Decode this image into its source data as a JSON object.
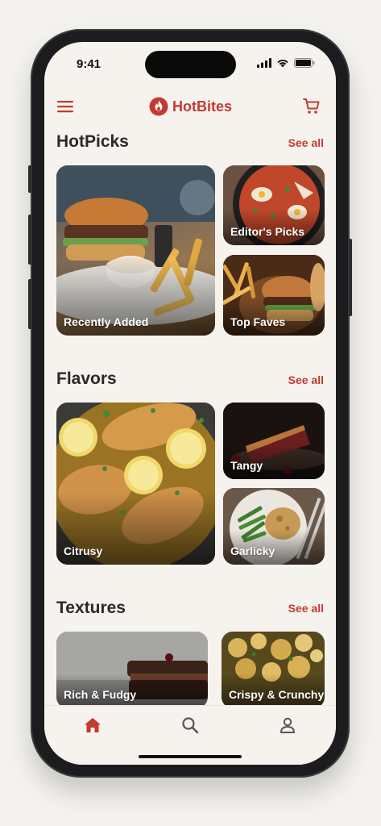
{
  "status_bar": {
    "time": "9:41"
  },
  "header": {
    "app_name": "HotBites",
    "icons": [
      "menu-icon",
      "flame-logo-icon",
      "cart-icon"
    ]
  },
  "colors": {
    "accent": "#c43a32",
    "background": "#f6f3ee",
    "heading": "#2a2a2a"
  },
  "sections": [
    {
      "title": "HotPicks",
      "see_all": "See all",
      "cards": [
        {
          "label": "Recently Added",
          "image": "burger-and-fries-photo"
        },
        {
          "label": "Editor's Picks",
          "image": "shakshuka-pan-photo"
        },
        {
          "label": "Top Faves",
          "image": "burger-fries-board-photo"
        }
      ]
    },
    {
      "title": "Flavors",
      "see_all": "See all",
      "cards": [
        {
          "label": "Citrusy",
          "image": "lemon-chicken-photo"
        },
        {
          "label": "Tangy",
          "image": "cherry-pie-photo"
        },
        {
          "label": "Garlicky",
          "image": "chicken-green-beans-photo"
        }
      ]
    },
    {
      "title": "Textures",
      "see_all": "See all",
      "cards": [
        {
          "label": "Rich & Fudgy",
          "image": "brownie-photo"
        },
        {
          "label": "Crispy & Crunchy",
          "image": "roasted-potatoes-photo"
        }
      ]
    }
  ],
  "tab_bar": {
    "active": "home",
    "tabs": [
      {
        "name": "home",
        "icon": "home-icon"
      },
      {
        "name": "search",
        "icon": "search-icon"
      },
      {
        "name": "profile",
        "icon": "profile-icon"
      }
    ]
  }
}
